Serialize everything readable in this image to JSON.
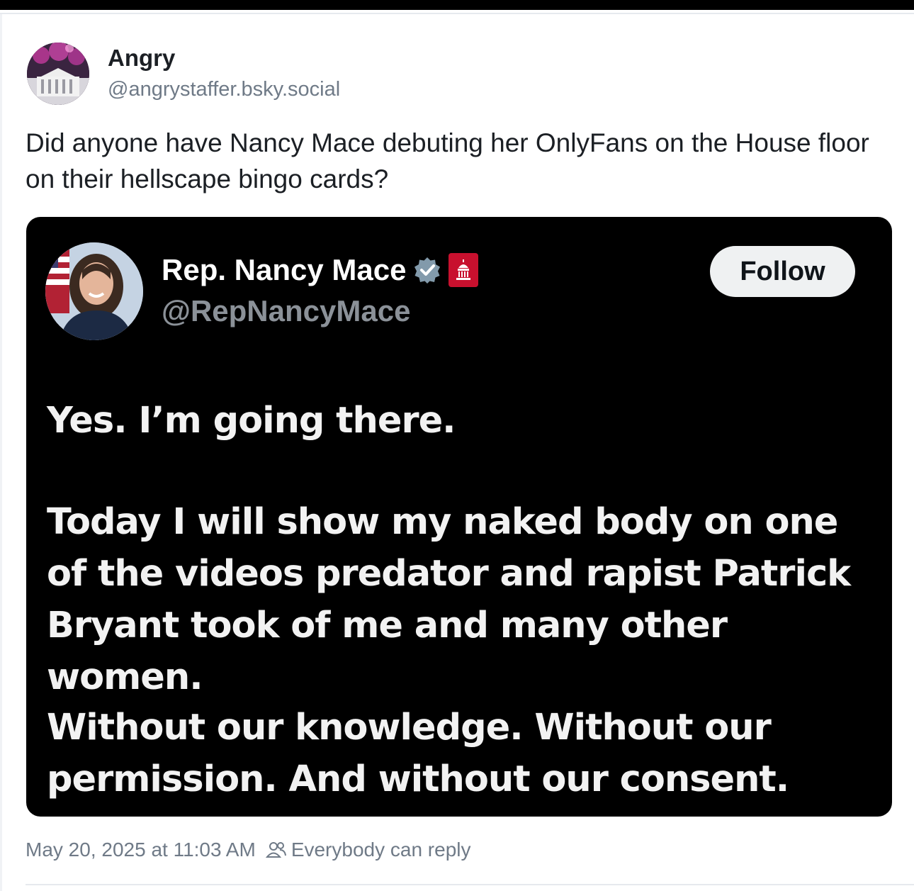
{
  "post": {
    "author_name": "Angry",
    "author_handle": "@angrystaffer.bsky.social",
    "text": "Did anyone have Nancy Mace debuting her OnlyFans on the House floor on their hellscape bingo cards?",
    "timestamp": "May 20, 2025 at 11:03 AM",
    "reply_setting": "Everybody can reply"
  },
  "embedded_post": {
    "name": "Rep. Nancy Mace",
    "handle": "@RepNancyMace",
    "follow_label": "Follow",
    "paragraphs": [
      "Yes. I’m going there.",
      "Today I will show my naked body on one of the videos predator and rapist Patrick Bryant took of me and many other women.",
      "Without our knowledge. Without our permission. And without our consent."
    ],
    "verified_color": "#829aab",
    "gov_badge_color": "#c8102e"
  },
  "icons": {
    "author_avatar": "white-house-avatar-icon",
    "quoted_avatar": "profile-photo-avatar-icon",
    "verified": "verified-badge-icon",
    "government": "government-label-icon",
    "reply": "people-icon"
  }
}
